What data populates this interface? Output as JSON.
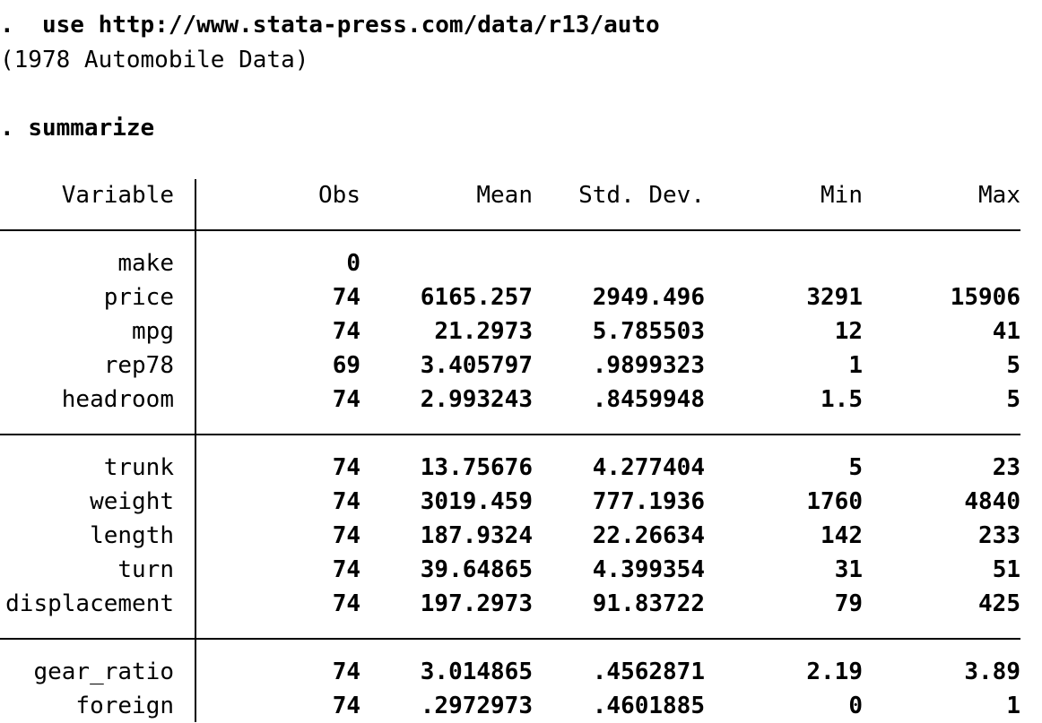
{
  "console": {
    "cmd1_prompt": ".",
    "cmd1": "use http://www.stata-press.com/data/r13/auto",
    "cmd1_output": "(1978 Automobile Data)",
    "cmd2_prompt": ".",
    "cmd2": "summarize"
  },
  "table": {
    "headers": {
      "variable": "Variable",
      "obs": "Obs",
      "mean": "Mean",
      "sd": "Std. Dev.",
      "min": "Min",
      "max": "Max"
    },
    "rows": [
      {
        "variable": "make",
        "obs": "0",
        "mean": "",
        "sd": "",
        "min": "",
        "max": ""
      },
      {
        "variable": "price",
        "obs": "74",
        "mean": "6165.257",
        "sd": "2949.496",
        "min": "3291",
        "max": "15906"
      },
      {
        "variable": "mpg",
        "obs": "74",
        "mean": "21.2973",
        "sd": "5.785503",
        "min": "12",
        "max": "41"
      },
      {
        "variable": "rep78",
        "obs": "69",
        "mean": "3.405797",
        "sd": ".9899323",
        "min": "1",
        "max": "5"
      },
      {
        "variable": "headroom",
        "obs": "74",
        "mean": "2.993243",
        "sd": ".8459948",
        "min": "1.5",
        "max": "5"
      },
      {
        "variable": "trunk",
        "obs": "74",
        "mean": "13.75676",
        "sd": "4.277404",
        "min": "5",
        "max": "23"
      },
      {
        "variable": "weight",
        "obs": "74",
        "mean": "3019.459",
        "sd": "777.1936",
        "min": "1760",
        "max": "4840"
      },
      {
        "variable": "length",
        "obs": "74",
        "mean": "187.9324",
        "sd": "22.26634",
        "min": "142",
        "max": "233"
      },
      {
        "variable": "turn",
        "obs": "74",
        "mean": "39.64865",
        "sd": "4.399354",
        "min": "31",
        "max": "51"
      },
      {
        "variable": "displacement",
        "obs": "74",
        "mean": "197.2973",
        "sd": "91.83722",
        "min": "79",
        "max": "425"
      },
      {
        "variable": "gear_ratio",
        "obs": "74",
        "mean": "3.014865",
        "sd": ".4562871",
        "min": "2.19",
        "max": "3.89"
      },
      {
        "variable": "foreign",
        "obs": "74",
        "mean": ".2972973",
        "sd": ".4601885",
        "min": "0",
        "max": "1"
      }
    ]
  }
}
